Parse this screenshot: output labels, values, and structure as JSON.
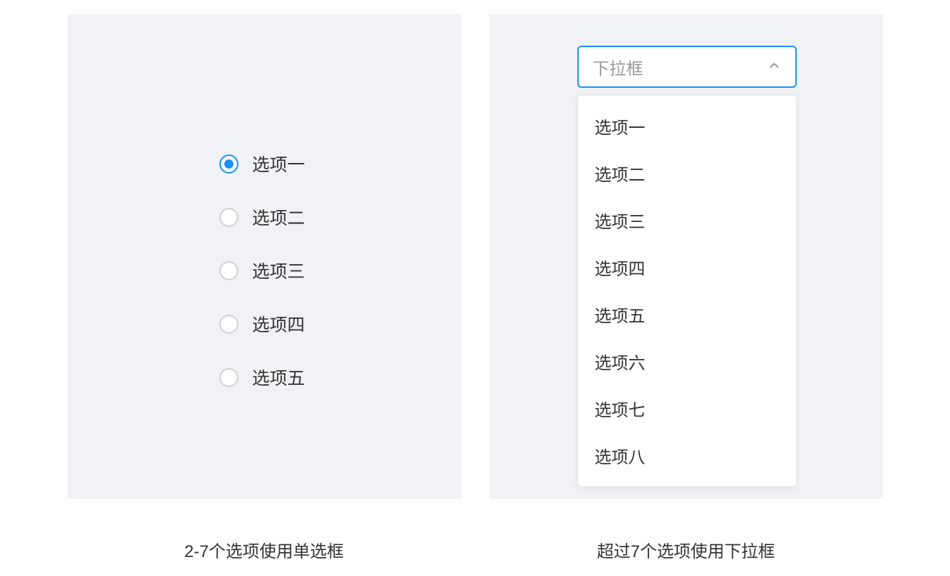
{
  "radio_panel": {
    "caption": "2-7个选项使用单选框",
    "options": [
      {
        "label": "选项一",
        "selected": true
      },
      {
        "label": "选项二",
        "selected": false
      },
      {
        "label": "选项三",
        "selected": false
      },
      {
        "label": "选项四",
        "selected": false
      },
      {
        "label": "选项五",
        "selected": false
      }
    ]
  },
  "dropdown_panel": {
    "caption": "超过7个选项使用下拉框",
    "placeholder": "下拉框",
    "options": [
      {
        "label": "选项一"
      },
      {
        "label": "选项二"
      },
      {
        "label": "选项三"
      },
      {
        "label": "选项四"
      },
      {
        "label": "选项五"
      },
      {
        "label": "选项六"
      },
      {
        "label": "选项七"
      },
      {
        "label": "选项八"
      }
    ]
  }
}
